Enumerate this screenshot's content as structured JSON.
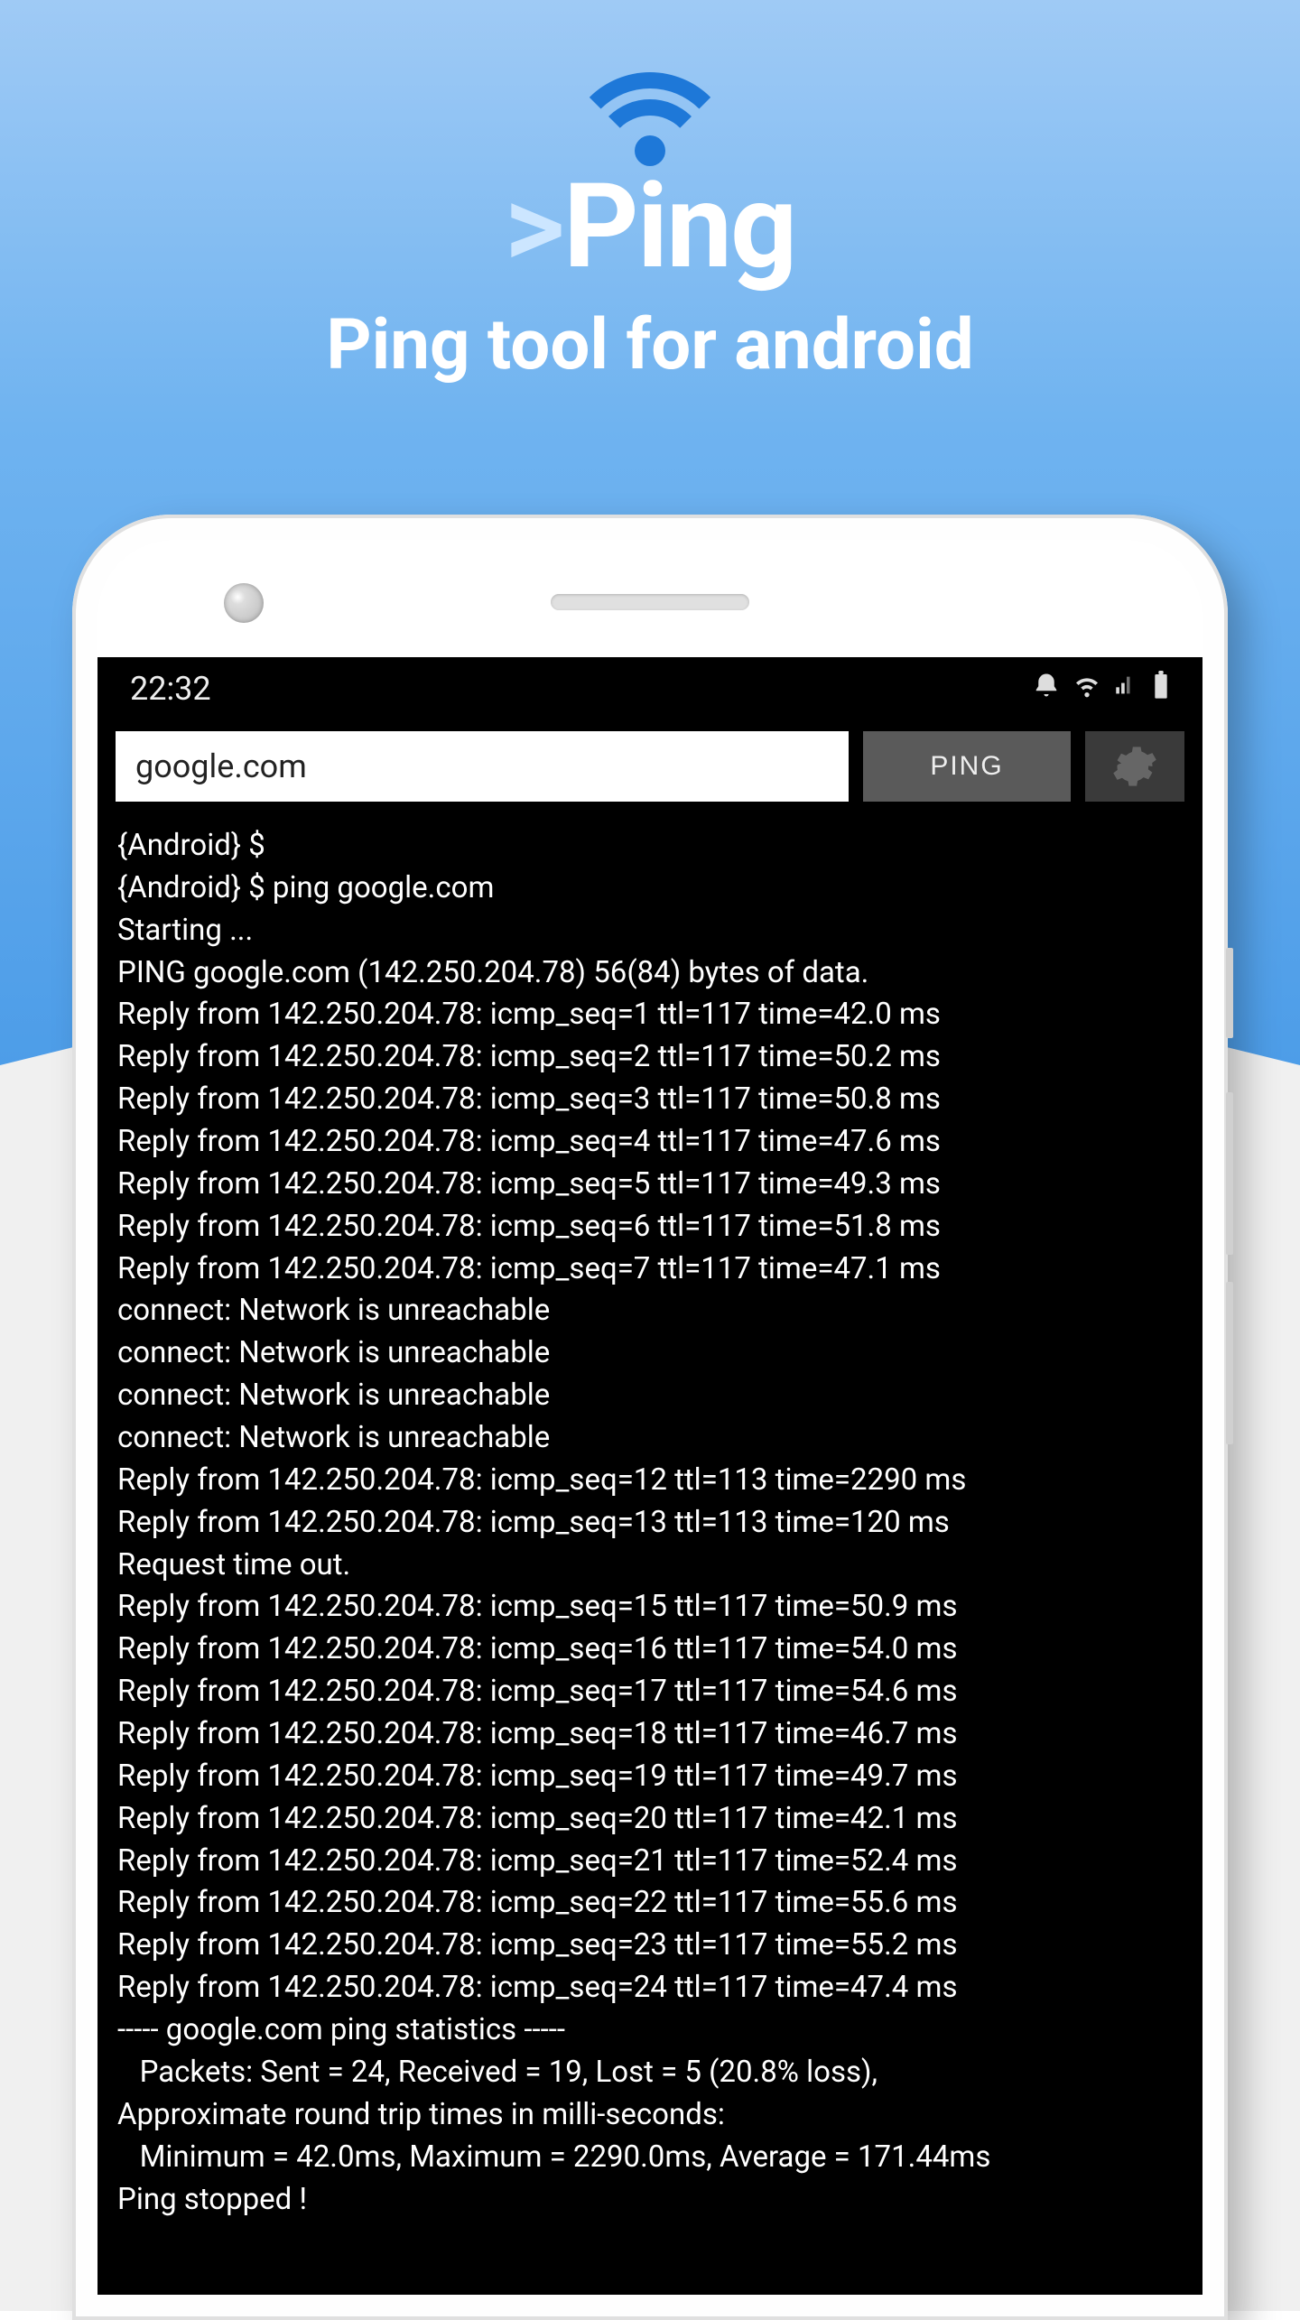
{
  "header": {
    "logo_prefix": ">",
    "logo_text": "Ping",
    "tagline": "Ping tool for android"
  },
  "status_bar": {
    "time": "22:32",
    "icons": {
      "alarm": "⏰",
      "wifi": "📶",
      "signal": "▫",
      "battery": "▮"
    }
  },
  "toolbar": {
    "host_value": "google.com",
    "ping_label": "PING"
  },
  "terminal": {
    "lines": [
      "{Android} $",
      "{Android} $ ping google.com",
      "Starting ...",
      "PING google.com (142.250.204.78) 56(84) bytes of data.",
      "Reply from 142.250.204.78: icmp_seq=1 ttl=117 time=42.0 ms",
      "Reply from 142.250.204.78: icmp_seq=2 ttl=117 time=50.2 ms",
      "Reply from 142.250.204.78: icmp_seq=3 ttl=117 time=50.8 ms",
      "Reply from 142.250.204.78: icmp_seq=4 ttl=117 time=47.6 ms",
      "Reply from 142.250.204.78: icmp_seq=5 ttl=117 time=49.3 ms",
      "Reply from 142.250.204.78: icmp_seq=6 ttl=117 time=51.8 ms",
      "Reply from 142.250.204.78: icmp_seq=7 ttl=117 time=47.1 ms",
      "connect: Network is unreachable",
      "connect: Network is unreachable",
      "connect: Network is unreachable",
      "connect: Network is unreachable",
      "Reply from 142.250.204.78: icmp_seq=12 ttl=113 time=2290 ms",
      "Reply from 142.250.204.78: icmp_seq=13 ttl=113 time=120 ms",
      "Request time out.",
      "Reply from 142.250.204.78: icmp_seq=15 ttl=117 time=50.9 ms",
      "Reply from 142.250.204.78: icmp_seq=16 ttl=117 time=54.0 ms",
      "Reply from 142.250.204.78: icmp_seq=17 ttl=117 time=54.6 ms",
      "Reply from 142.250.204.78: icmp_seq=18 ttl=117 time=46.7 ms",
      "Reply from 142.250.204.78: icmp_seq=19 ttl=117 time=49.7 ms",
      "Reply from 142.250.204.78: icmp_seq=20 ttl=117 time=42.1 ms",
      "Reply from 142.250.204.78: icmp_seq=21 ttl=117 time=52.4 ms",
      "Reply from 142.250.204.78: icmp_seq=22 ttl=117 time=55.6 ms",
      "Reply from 142.250.204.78: icmp_seq=23 ttl=117 time=55.2 ms",
      "Reply from 142.250.204.78: icmp_seq=24 ttl=117 time=47.4 ms",
      "----- google.com ping statistics -----",
      "   Packets: Sent = 24, Received = 19, Lost = 5 (20.8% loss),",
      "Approximate round trip times in milli-seconds:",
      "   Minimum = 42.0ms, Maximum = 2290.0ms, Average = 171.44ms",
      "Ping stopped !"
    ]
  }
}
